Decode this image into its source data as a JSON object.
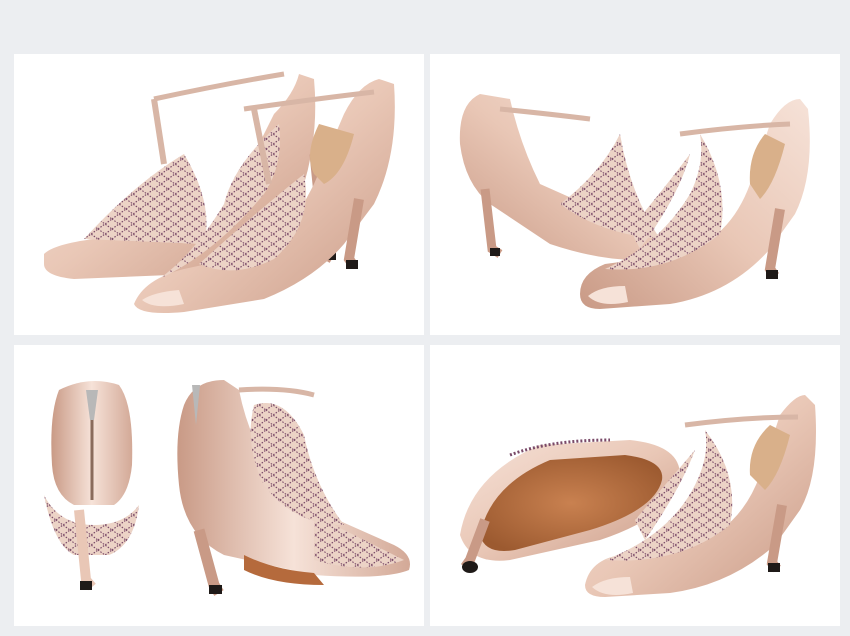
{
  "caption": {
    "lines": [
      "",
      "",
      "",
      ""
    ]
  },
  "panels": [
    {
      "view": "front-pair"
    },
    {
      "view": "side-pair"
    },
    {
      "view": "back-pair"
    },
    {
      "view": "sole-pair"
    }
  ],
  "colors": {
    "satin": "#e9c7b6",
    "satin_shadow": "#c99a86",
    "satin_light": "#f6e2d8",
    "insole": "#d9b08a",
    "sole": "#b56a3c",
    "heel_tip": "#1f1a18",
    "rhinestone": "#7a4a68",
    "background": "#eceef1"
  }
}
